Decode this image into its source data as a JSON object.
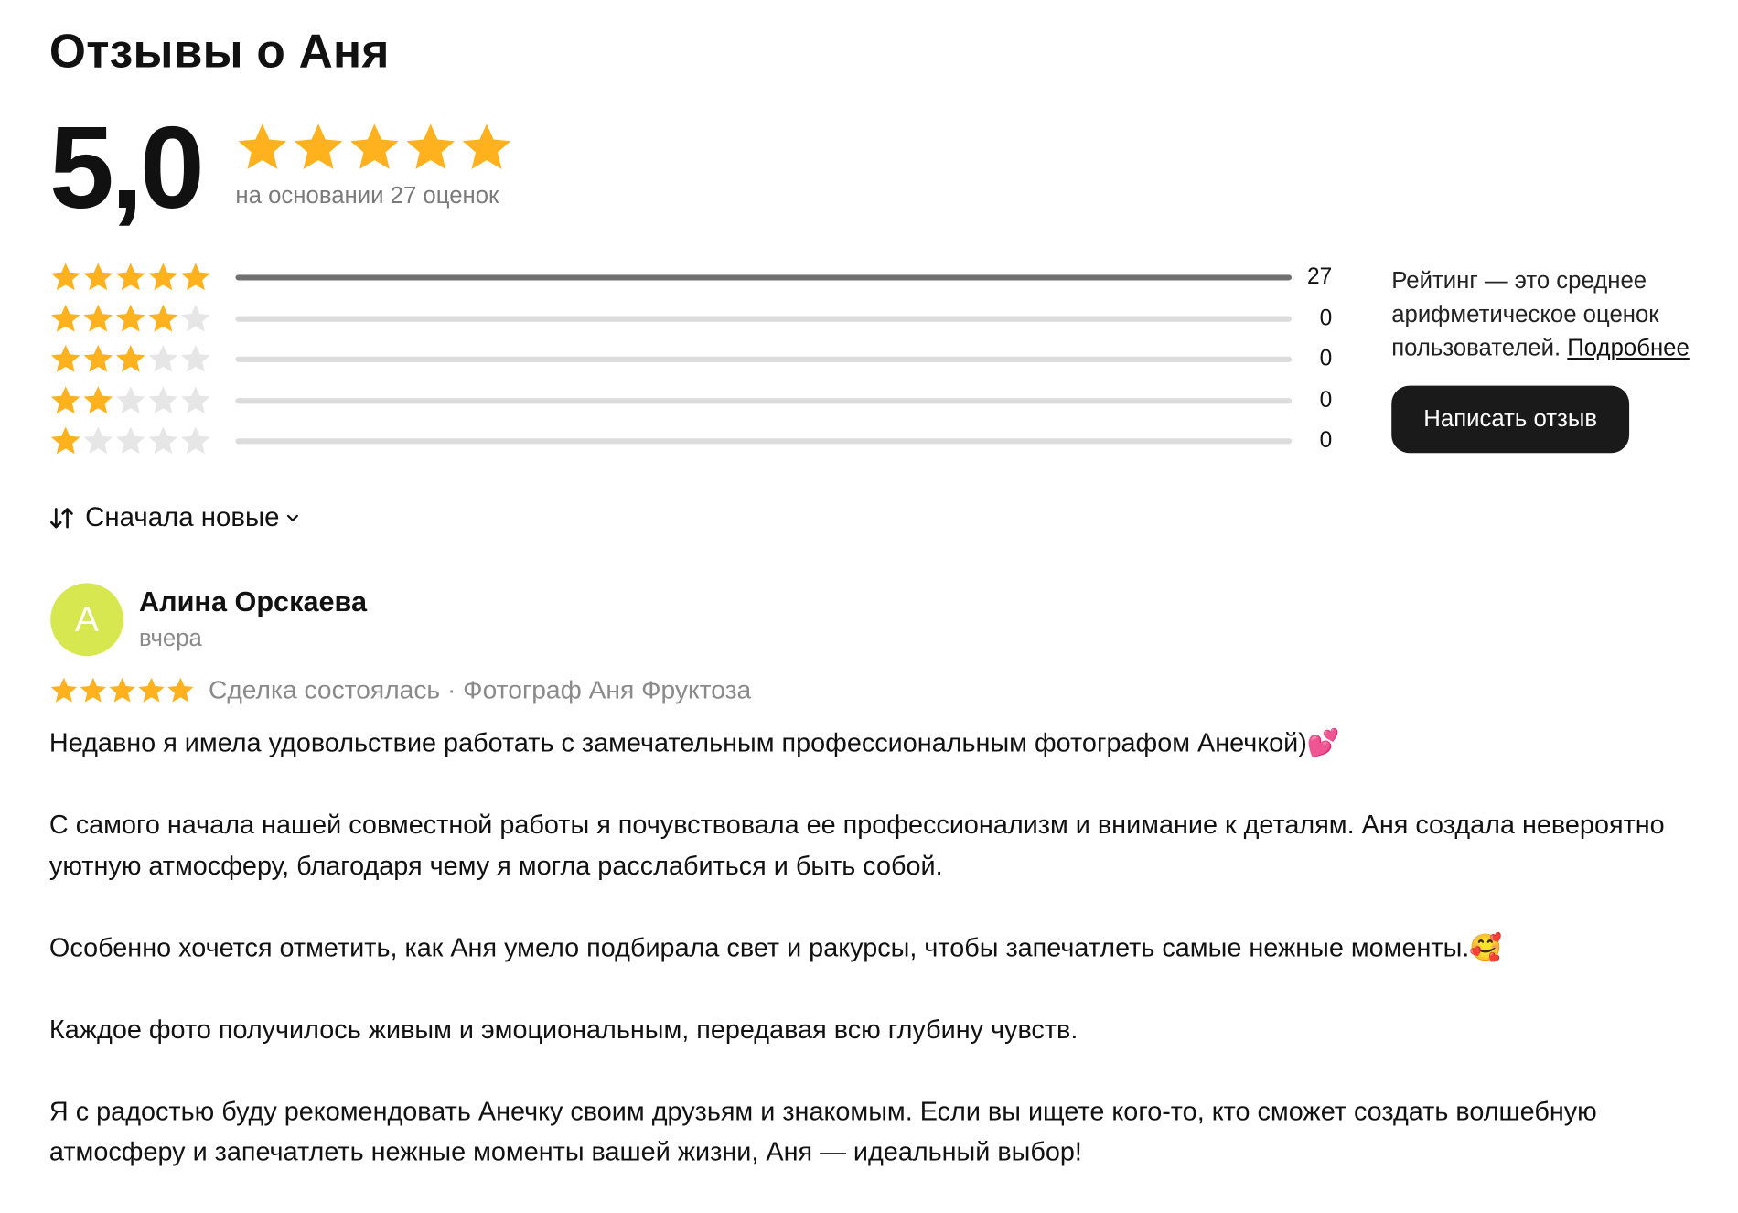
{
  "page": {
    "title": "Отзывы о Аня"
  },
  "summary": {
    "score": "5,0",
    "stars": 5,
    "basis_text": "на основании 27 оценок",
    "star_color": "#ffb21e",
    "empty_star_color": "#e6e6e6"
  },
  "distribution": [
    {
      "stars": 5,
      "count": "27",
      "share": 1.0
    },
    {
      "stars": 4,
      "count": "0",
      "share": 0
    },
    {
      "stars": 3,
      "count": "0",
      "share": 0
    },
    {
      "stars": 2,
      "count": "0",
      "share": 0
    },
    {
      "stars": 1,
      "count": "0",
      "share": 0
    }
  ],
  "rating_note": {
    "text": "Рейтинг — это среднее арифметическое оценок пользователей.",
    "link": "Подробнее"
  },
  "actions": {
    "write_review": "Написать отзыв"
  },
  "sort": {
    "label": "Сначала новые",
    "icon": "sort-arrows-icon",
    "chevron": "chevron-down-icon"
  },
  "review": {
    "avatar_letter": "А",
    "avatar_color": "#d7e750",
    "author": "Алина Орскаева",
    "date": "вчера",
    "rating": 5,
    "meta": "Сделка состоялась · Фотограф Аня Фруктоза",
    "paragraphs": [
      "Недавно я имела удовольствие работать с замечательным профессиональным фотографом Анечкой)💕",
      "С самого начала нашей совместной работы я почувствовала ее профессионализм и внимание к деталям. Аня создала невероятно уютную атмосферу, благодаря чему я могла расслабиться и быть собой.",
      "Особенно хочется отметить, как Аня умело подбирала свет и ракурсы, чтобы запечатлеть самые нежные моменты.🥰",
      "Каждое фото получилось живым и эмоциональным, передавая всю глубину чувств.",
      "Я с радостью буду рекомендовать Анечку своим друзьям и знакомым. Если вы ищете кого-то, кто сможет создать волшебную атмосферу и запечатлеть нежные моменты вашей жизни, Аня — идеальный выбор!"
    ]
  }
}
